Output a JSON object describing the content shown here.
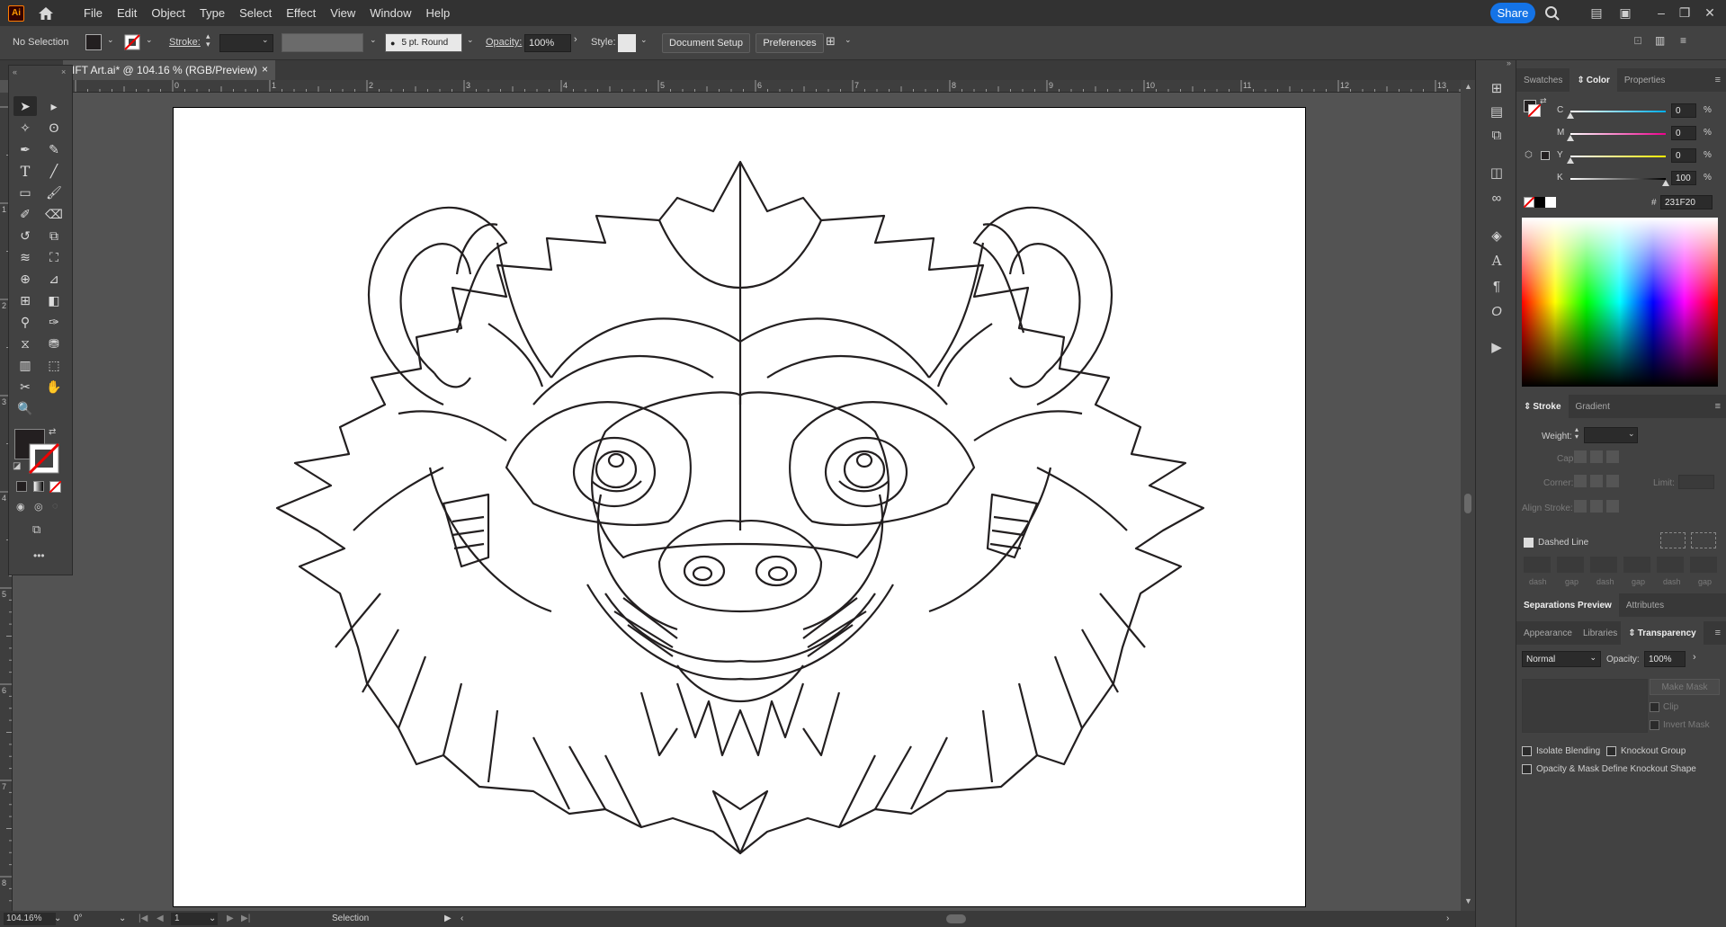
{
  "app": {
    "logo": "Ai",
    "menu": [
      "File",
      "Edit",
      "Object",
      "Type",
      "Select",
      "Effect",
      "View",
      "Window",
      "Help"
    ],
    "share_label": "Share"
  },
  "control_bar": {
    "selection_status": "No Selection",
    "stroke_label": "Stroke:",
    "brush_label": "5 pt. Round",
    "opacity_label": "Opacity:",
    "opacity_value": "100%",
    "style_label": "Style:",
    "document_setup": "Document Setup",
    "preferences": "Preferences"
  },
  "document": {
    "tab_title": "IFT Art.ai* @ 104.16 % (RGB/Preview)",
    "close_glyph": "×"
  },
  "rulers": {
    "horizontal": [
      "0",
      "1",
      "2",
      "3",
      "4",
      "5",
      "6",
      "7",
      "8",
      "9",
      "10",
      "11",
      "12",
      "13"
    ],
    "vertical": [
      "1",
      "2",
      "3",
      "4",
      "5",
      "6",
      "7",
      "8"
    ]
  },
  "status_bar": {
    "zoom": "104.16%",
    "rotation": "0°",
    "artboard_number": "1",
    "tool": "Selection"
  },
  "color_panel": {
    "tabs": [
      "Swatches",
      "Color",
      "Properties"
    ],
    "active_tab": "Color",
    "channels": [
      {
        "name": "C",
        "value": "0",
        "unit": "%"
      },
      {
        "name": "M",
        "value": "0",
        "unit": "%"
      },
      {
        "name": "Y",
        "value": "0",
        "unit": "%"
      },
      {
        "name": "K",
        "value": "100",
        "unit": "%"
      }
    ],
    "hex_prefix": "#",
    "hex": "231F20"
  },
  "stroke_panel": {
    "tabs": [
      "Stroke",
      "Gradient"
    ],
    "weight_label": "Weight:",
    "cap_label": "Cap:",
    "corner_label": "Corner:",
    "limit_label": "Limit:",
    "align_label": "Align Stroke:",
    "dashed_line_label": "Dashed Line",
    "dash_labels": [
      "dash",
      "gap",
      "dash",
      "gap",
      "dash",
      "gap"
    ]
  },
  "sep_panel": {
    "tabs": [
      "Separations Preview",
      "Attributes"
    ]
  },
  "transparency_panel": {
    "tabs": [
      "Appearance",
      "Libraries",
      "Transparency"
    ],
    "blend_mode": "Normal",
    "opacity_label": "Opacity:",
    "opacity_value": "100%",
    "make_mask": "Make Mask",
    "clip_label": "Clip",
    "invert_mask_label": "Invert Mask",
    "isolate_blending": "Isolate Blending",
    "knockout_group": "Knockout Group",
    "opacity_mask_knockout": "Opacity & Mask Define Knockout Shape"
  },
  "colors": {
    "fill": "#231F20",
    "accent": "#1473e6"
  }
}
